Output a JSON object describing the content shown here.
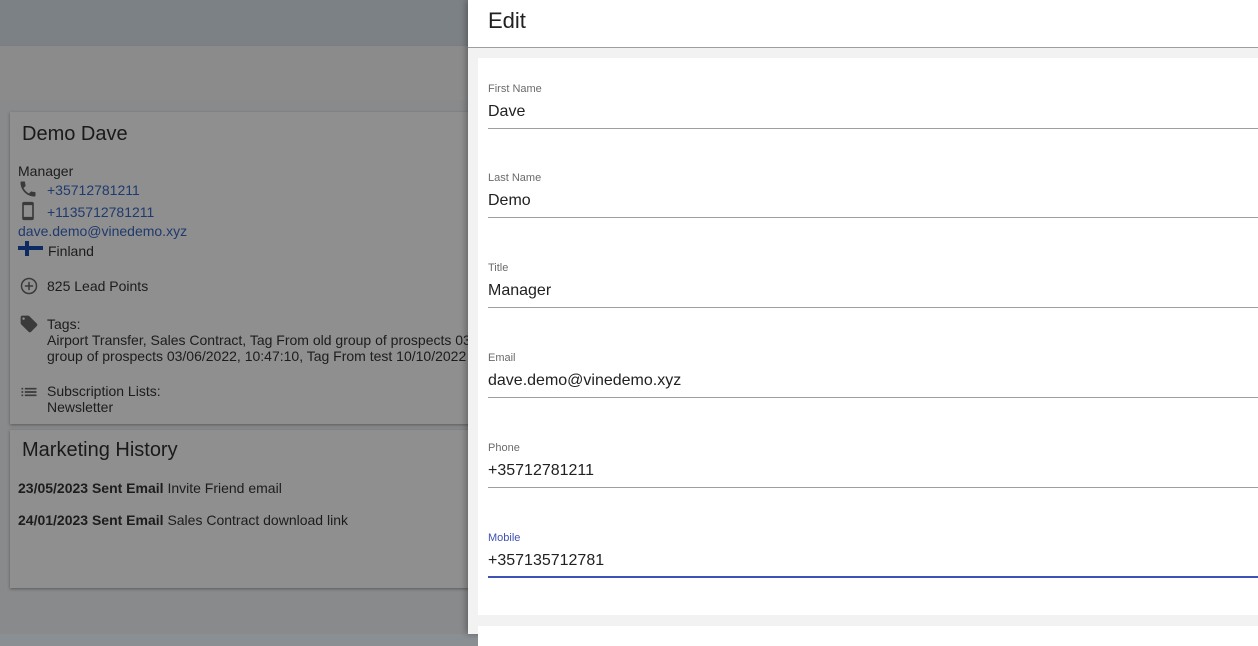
{
  "contact": {
    "name": "Demo Dave",
    "title": "Manager",
    "phone": "+35712781211",
    "mobile": "+1135712781211",
    "email": "dave.demo@vinedemo.xyz",
    "country": "Finland",
    "lead_points": "825 Lead Points",
    "tags_label": "Tags:",
    "tags_line1": "Airport Transfer, Sales Contract, Tag From old group of prospects 03",
    "tags_line2": "group of prospects 03/06/2022, 10:47:10, Tag From test 10/10/2022",
    "subscriptions_label": "Subscription Lists:",
    "subscriptions_value": "Newsletter"
  },
  "marketing_history": {
    "title": "Marketing History",
    "entries": [
      {
        "date_event": "23/05/2023 Sent Email",
        "detail": "Invite Friend email"
      },
      {
        "date_event": "24/01/2023 Sent Email",
        "detail": "Sales Contract download link"
      }
    ]
  },
  "icons": {
    "phone": "phone-icon",
    "mobile": "smartphone-icon",
    "flag": "finland-flag-icon",
    "lead": "add-circle-icon",
    "tags": "tag-icon",
    "subscriptions": "list-icon"
  },
  "edit": {
    "title": "Edit",
    "fields": [
      {
        "label": "First Name",
        "value": "Dave"
      },
      {
        "label": "Last Name",
        "value": "Demo"
      },
      {
        "label": "Title",
        "value": "Manager"
      },
      {
        "label": "Email",
        "value": "dave.demo@vinedemo.xyz"
      },
      {
        "label": "Phone",
        "value": "+35712781211"
      },
      {
        "label": "Mobile",
        "value": "+357135712781"
      }
    ]
  },
  "colors": {
    "accent": "#3f51b5",
    "link": "#1f3a6e"
  }
}
